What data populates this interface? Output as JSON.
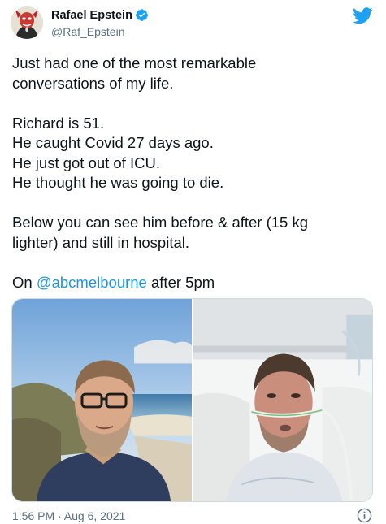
{
  "author": {
    "display_name": "Rafael Epstein",
    "handle": "@Raf_Epstein",
    "verified": true
  },
  "tweet": {
    "paragraph1": [
      "Just had one of the most remarkable",
      "conversations of my life."
    ],
    "paragraph2": [
      "Richard is 51.",
      "He caught Covid 27 days ago.",
      "He just got out of ICU.",
      "He thought he was going to die."
    ],
    "paragraph3": [
      "Below you can see him before & after (15 kg",
      "lighter) and still in hospital."
    ],
    "paragraph4": {
      "prefix": "On ",
      "mention": "@abcmelbourne",
      "suffix": " after 5pm"
    }
  },
  "media": {
    "images": [
      {
        "subject": "selfie-before",
        "alt_icon": "photo-icon"
      },
      {
        "subject": "hospital-after",
        "alt_icon": "photo-icon"
      }
    ]
  },
  "footer": {
    "timestamp": "1:56 PM · Aug 6, 2021"
  },
  "colors": {
    "text": "#0f1419",
    "muted": "#5b7083",
    "link": "#1b95e0",
    "brand": "#1da1f2"
  },
  "icons": [
    "verified-badge-icon",
    "twitter-bird-icon",
    "info-icon"
  ]
}
